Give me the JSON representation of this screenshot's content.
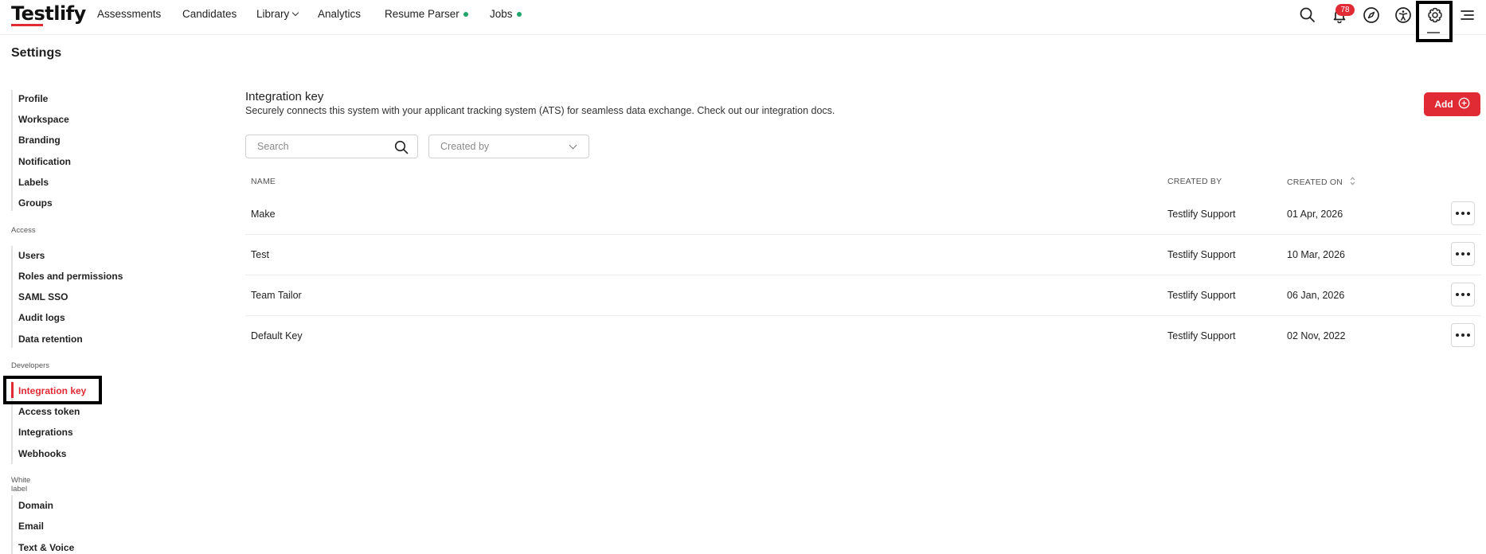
{
  "header": {
    "logo": "Testlify",
    "nav": [
      {
        "label": "Assessments"
      },
      {
        "label": "Candidates"
      },
      {
        "label": "Library"
      },
      {
        "label": "Analytics"
      },
      {
        "label": "Resume Parser"
      },
      {
        "label": "Jobs"
      }
    ],
    "notification_count": "78",
    "icons": [
      "search-icon",
      "bell-icon",
      "compass-icon",
      "accessibility-icon",
      "gear-icon",
      "menu-icon"
    ]
  },
  "page": {
    "title": "Settings"
  },
  "sidebar": {
    "general": [
      "Profile",
      "Workspace",
      "Branding",
      "Notification",
      "Labels",
      "Groups"
    ],
    "access_title": "Access",
    "access": [
      "Users",
      "Roles and permissions",
      "SAML SSO",
      "Audit logs",
      "Data retention"
    ],
    "developers_title": "Developers",
    "developers": [
      "Integration key",
      "Access token",
      "Integrations",
      "Webhooks"
    ],
    "white_label_title": "White label",
    "white_label": [
      "Domain",
      "Email",
      "Text & Voice"
    ]
  },
  "main": {
    "title": "Integration key",
    "description": "Securely connects this system with your applicant tracking system (ATS) for seamless data exchange. Check out our integration docs.",
    "add_label": "Add",
    "search_placeholder": "Search",
    "created_by_placeholder": "Created by",
    "columns": {
      "name": "NAME",
      "created_by": "CREATED BY",
      "created_on": "CREATED ON"
    },
    "rows": [
      {
        "name": "Make",
        "created_by": "Testlify Support",
        "created_on": "01 Apr, 2026"
      },
      {
        "name": "Test",
        "created_by": "Testlify Support",
        "created_on": "10 Mar, 2026"
      },
      {
        "name": "Team Tailor",
        "created_by": "Testlify Support",
        "created_on": "06 Jan, 2026"
      },
      {
        "name": "Default Key",
        "created_by": "Testlify Support",
        "created_on": "02 Nov, 2022"
      }
    ]
  },
  "colors": {
    "accent": "#e02b35",
    "status_dot": "#1fa56a"
  }
}
